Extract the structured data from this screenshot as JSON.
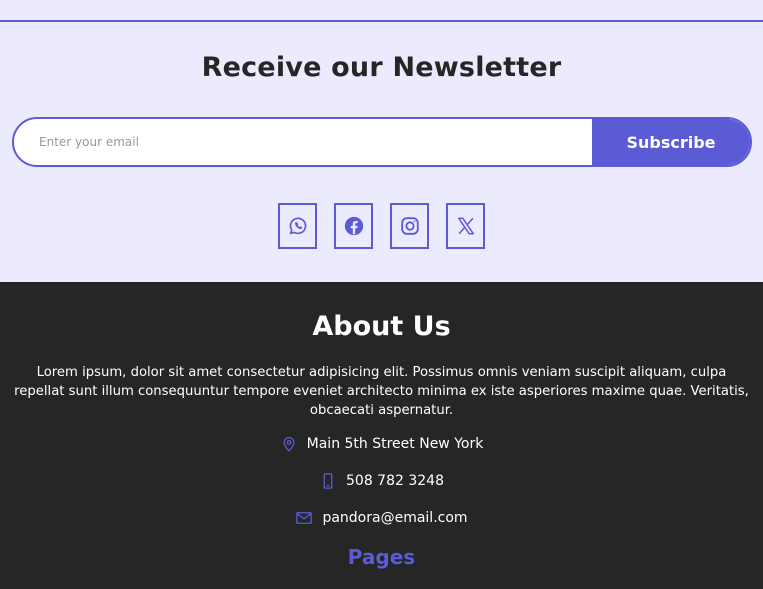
{
  "newsletter": {
    "title": "Receive our Newsletter",
    "email_placeholder": "Enter your email",
    "subscribe_label": "Subscribe"
  },
  "socials": [
    "whatsapp-icon",
    "facebook-icon",
    "instagram-icon",
    "x-icon"
  ],
  "about": {
    "title": "About Us",
    "text": "Lorem ipsum, dolor sit amet consectetur adipisicing elit. Possimus omnis veniam suscipit aliquam, culpa repellat sunt illum consequuntur tempore eveniet architecto minima ex iste asperiores maxime quae. Veritatis, obcaecati aspernatur."
  },
  "contact": {
    "address": "Main 5th Street New York",
    "phone": "508 782 3248",
    "email": "pandora@email.com"
  },
  "pages": {
    "title": "Pages"
  },
  "colors": {
    "accent": "#5b5bd6",
    "newsletter_bg": "#ecebfd",
    "footer_bg": "#262626"
  }
}
